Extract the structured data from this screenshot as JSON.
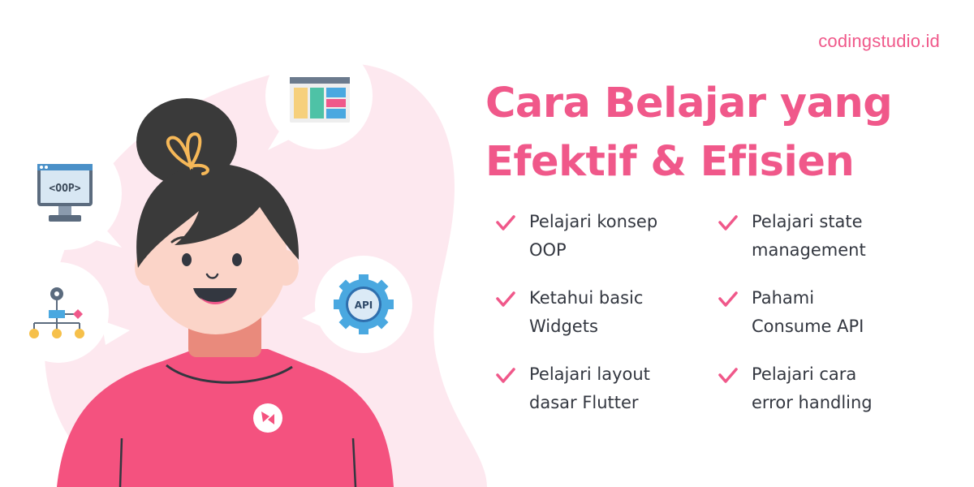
{
  "brand": {
    "name": "codingstudio.id"
  },
  "headline": {
    "line1": "Cara Belajar yang",
    "line2": "Efektif & Efisien"
  },
  "tips": [
    {
      "text": "Pelajari konsep\nOOP"
    },
    {
      "text": "Pelajari state\nmanagement"
    },
    {
      "text": "Ketahui basic\nWidgets"
    },
    {
      "text": "Pahami\nConsume API"
    },
    {
      "text": "Pelajari layout\ndasar Flutter"
    },
    {
      "text": "Pelajari cara\nerror handling"
    }
  ],
  "bubbles": {
    "oop": {
      "icon": "oop-monitor-icon",
      "label": "<OOP>"
    },
    "layout": {
      "icon": "layout-window-icon"
    },
    "widgets": {
      "icon": "widget-tree-icon"
    },
    "api": {
      "icon": "api-gear-icon",
      "label": "API"
    }
  },
  "colors": {
    "accent": "#f0588a",
    "text": "#333740",
    "blob": "#fde8ef",
    "shirt": "#f4527f",
    "hair": "#3a3a3a",
    "skin": "#fbd4c8"
  }
}
